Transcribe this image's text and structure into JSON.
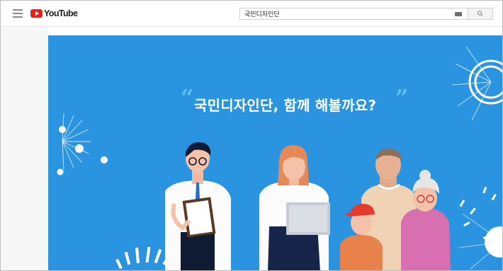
{
  "header": {
    "brand": "YouTube",
    "search": {
      "value": "국민디자인단",
      "placeholder": ""
    }
  },
  "video": {
    "headline": "국민디자인단, 함께 해볼까요?",
    "quote_open": "“",
    "quote_close": "”"
  },
  "icons": {
    "menu": "hamburger-menu-icon",
    "logo": "youtube-logo-icon",
    "keyboard": "keyboard-icon",
    "search": "search-icon"
  },
  "colors": {
    "brand_red": "#e5231b",
    "video_background": "#2a94e0",
    "quote_accent": "#60bff0"
  }
}
